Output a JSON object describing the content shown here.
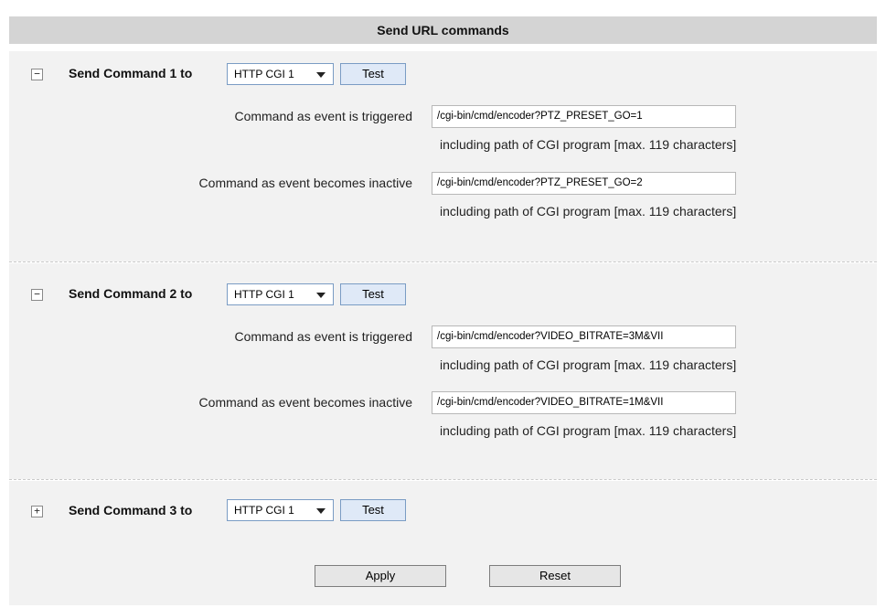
{
  "header": {
    "title": "Send URL commands"
  },
  "commands": [
    {
      "toggle": "−",
      "label": "Send Command 1 to",
      "target": "HTTP CGI 1",
      "test_label": "Test",
      "triggered_label": "Command as event is triggered",
      "triggered_value": "/cgi-bin/cmd/encoder?PTZ_PRESET_GO=1",
      "triggered_hint": "including path of CGI program [max. 119 characters]",
      "inactive_label": "Command as event becomes inactive",
      "inactive_value": "/cgi-bin/cmd/encoder?PTZ_PRESET_GO=2",
      "inactive_hint": "including path of CGI program [max. 119 characters]"
    },
    {
      "toggle": "−",
      "label": "Send Command 2 to",
      "target": "HTTP CGI 1",
      "test_label": "Test",
      "triggered_label": "Command as event is triggered",
      "triggered_value": "/cgi-bin/cmd/encoder?VIDEO_BITRATE=3M&VII",
      "triggered_hint": "including path of CGI program [max. 119 characters]",
      "inactive_label": "Command as event becomes inactive",
      "inactive_value": "/cgi-bin/cmd/encoder?VIDEO_BITRATE=1M&VII",
      "inactive_hint": "including path of CGI program [max. 119 characters]"
    },
    {
      "toggle": "+",
      "label": "Send Command 3 to",
      "target": "HTTP CGI 1",
      "test_label": "Test"
    }
  ],
  "actions": {
    "apply_label": "Apply",
    "reset_label": "Reset"
  }
}
